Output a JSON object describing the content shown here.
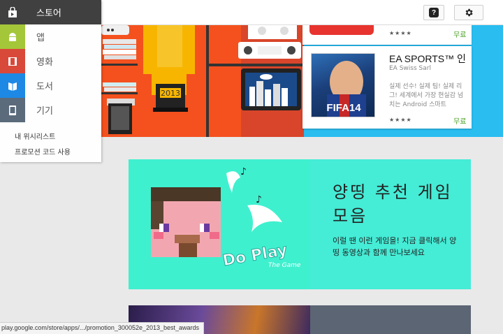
{
  "sidebar": {
    "items": [
      {
        "label": "스토어",
        "icon": "store-bag-icon",
        "color": "#404040"
      },
      {
        "label": "앱",
        "icon": "android-icon",
        "color": "#a4c639"
      },
      {
        "label": "영화",
        "icon": "film-icon",
        "color": "#d9493a"
      },
      {
        "label": "도서",
        "icon": "book-icon",
        "color": "#1e88e5"
      },
      {
        "label": "기기",
        "icon": "device-icon",
        "color": "#5b6b7b"
      }
    ],
    "links": [
      "내 위시리스트",
      "프로모션 코드 사용"
    ]
  },
  "header": {
    "help_icon": "help-icon",
    "settings_icon": "gear-icon"
  },
  "hero": {
    "trophy_year": "2013",
    "top_card": {
      "rating": "★★★★",
      "price": "무료"
    },
    "app_card": {
      "title": "EA SPORTS™ 인",
      "developer": "EA Swiss Sarl",
      "description": "실제 선수! 실제 팀! 실제 리그! 세계에서 가장 현실감 넘치는 Android 스마트",
      "thumb_label": "FIFA14",
      "rating": "★★★★",
      "price": "무료"
    }
  },
  "banner": {
    "title": "양띵 추천 게임 모음",
    "description": "이럴 땐 이런 게임을! 지금 클릭해서 양띵 동영상과 함께 만나보세요",
    "logo_text": "Do Play",
    "logo_subtext": "The Game"
  },
  "status_url": "play.google.com/store/apps/.../promotion_300052e_2013_best_awards",
  "colors": {
    "hero_blue": "#29bdf0",
    "banner_teal": "#45ecd6",
    "free_green": "#4aa226"
  }
}
